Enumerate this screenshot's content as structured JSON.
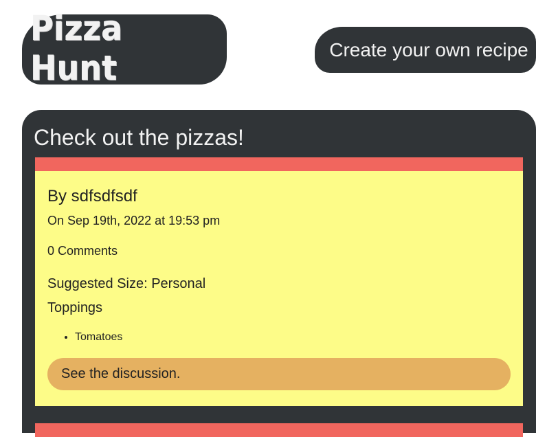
{
  "header": {
    "logo_text": "Pizza Hunt",
    "create_link": "Create your own recipe"
  },
  "main": {
    "title": "Check out the pizzas!"
  },
  "pizzas": [
    {
      "author": "By sdfsdfsdf",
      "date": "On Sep 19th, 2022 at 19:53 pm",
      "comments": "0 Comments",
      "size": "Suggested Size: Personal",
      "toppings_label": "Toppings",
      "toppings": [
        "Tomatoes"
      ],
      "discussion_label": "See the discussion."
    }
  ],
  "colors": {
    "dark": "#303437",
    "card_bg": "#fdfc88",
    "card_band": "#f1665e",
    "button": "#e5b161"
  }
}
